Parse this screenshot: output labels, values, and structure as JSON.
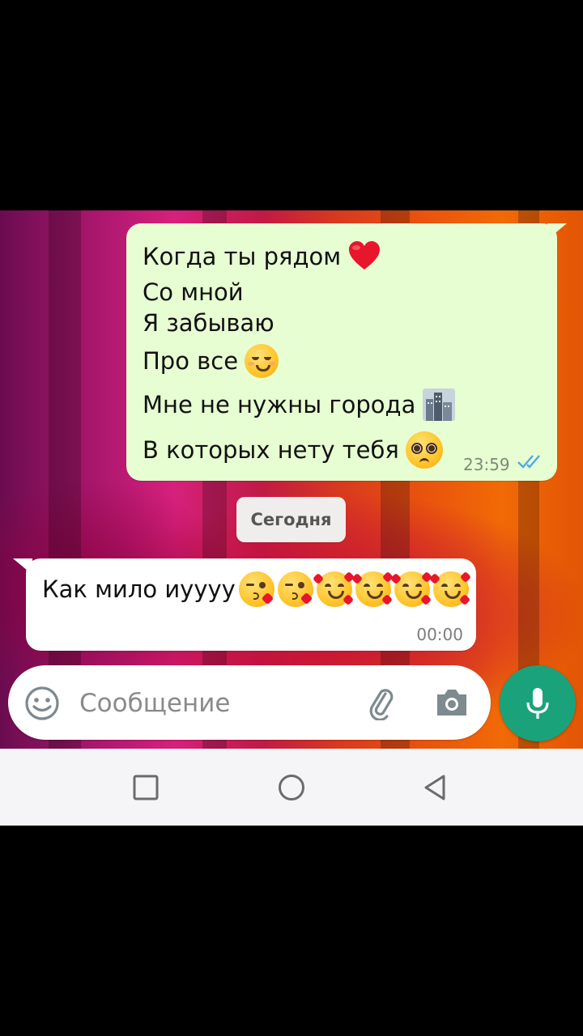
{
  "messages": {
    "outgoing": {
      "lines": [
        {
          "text": "Когда ты рядом",
          "emoji": "red-heart-emoji"
        },
        {
          "text": "Со мной"
        },
        {
          "text": "Я забываю"
        },
        {
          "text": "Про все",
          "emoji": "relieved-face-emoji"
        },
        {
          "text": "Мне не нужны города",
          "emoji": "cityscape-emoji"
        },
        {
          "text": "В которых нету тебя",
          "emoji": "pleading-face-emoji"
        }
      ],
      "time": "23:59",
      "status": "read"
    },
    "date_separator": "Сегодня",
    "incoming": {
      "text": "Как мило иуууу",
      "emojis": [
        "kissing-heart-emoji",
        "kissing-heart-emoji",
        "smiling-face-with-hearts-emoji",
        "smiling-face-with-hearts-emoji",
        "smiling-face-with-hearts-emoji",
        "smiling-face-with-hearts-emoji"
      ],
      "time": "00:00"
    }
  },
  "composer": {
    "placeholder": "Сообщение",
    "value": ""
  },
  "icons": [
    "emoji-icon",
    "attach-icon",
    "camera-icon",
    "mic-icon",
    "recent-apps-icon",
    "home-icon",
    "back-icon"
  ],
  "colors": {
    "outgoing_bubble": "#e7fed2",
    "incoming_bubble": "#ffffff",
    "accent": "#1aa37a",
    "read_ticks": "#4fa8e6"
  }
}
